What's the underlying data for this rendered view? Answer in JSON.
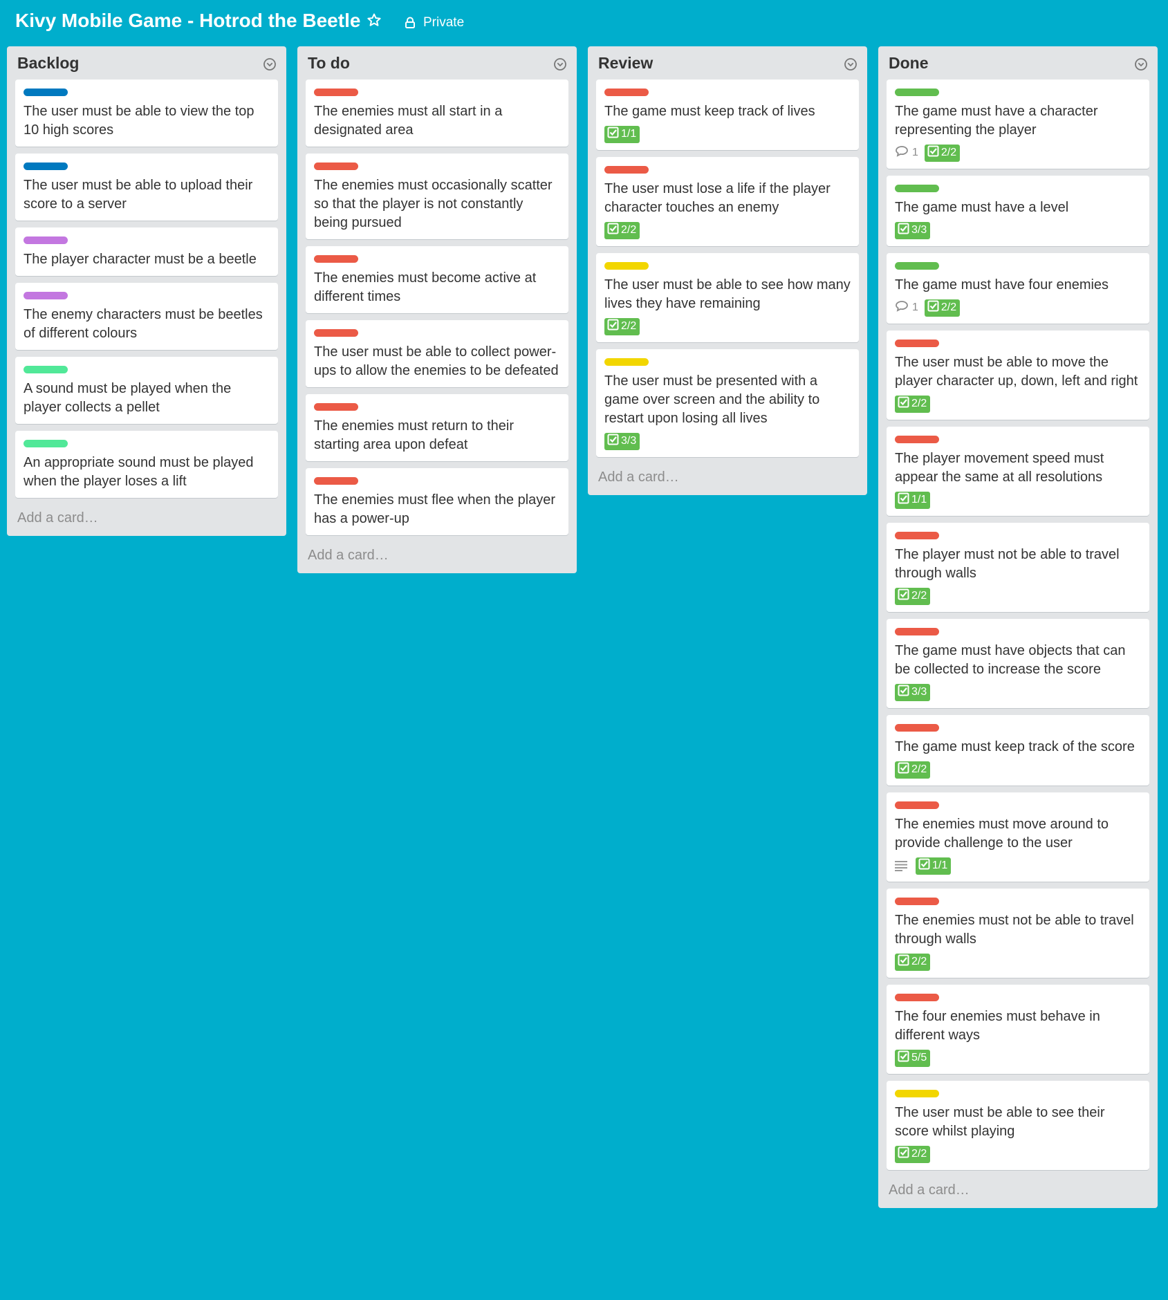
{
  "board": {
    "title": "Kivy Mobile Game - Hotrod the Beetle",
    "visibility": "Private"
  },
  "colors": {
    "background": "#00AECC",
    "list_bg": "#E2E4E6",
    "check_green": "#61BD4F"
  },
  "add_card_label": "Add a card…",
  "lists": [
    {
      "title": "Backlog",
      "cards": [
        {
          "label_color": "#0079BF",
          "text": "The user must be able to view the top 10 high scores"
        },
        {
          "label_color": "#0079BF",
          "text": "The user must be able to upload their score to a server"
        },
        {
          "label_color": "#C377E0",
          "text": "The player character must be a beetle"
        },
        {
          "label_color": "#C377E0",
          "text": "The enemy characters must be beetles of different colours"
        },
        {
          "label_color": "#51E898",
          "text": "A sound must be played when the player collects a pellet"
        },
        {
          "label_color": "#51E898",
          "text": "An appropriate sound must be played when the player loses a lift"
        }
      ]
    },
    {
      "title": "To do",
      "cards": [
        {
          "label_color": "#EB5A46",
          "text": "The enemies must all start in a designated area"
        },
        {
          "label_color": "#EB5A46",
          "text": "The enemies must occasionally scatter so that the player is not constantly being pursued"
        },
        {
          "label_color": "#EB5A46",
          "text": "The enemies must become active at different times"
        },
        {
          "label_color": "#EB5A46",
          "text": "The user must be able to collect power-ups to allow the enemies to be defeated"
        },
        {
          "label_color": "#EB5A46",
          "text": "The enemies must return to their starting area upon defeat"
        },
        {
          "label_color": "#EB5A46",
          "text": "The enemies must flee when the player has a power-up"
        }
      ]
    },
    {
      "title": "Review",
      "cards": [
        {
          "label_color": "#EB5A46",
          "text": "The game must keep track of lives",
          "checklist": "1/1"
        },
        {
          "label_color": "#EB5A46",
          "text": "The user must lose a life if the player character touches an enemy",
          "checklist": "2/2"
        },
        {
          "label_color": "#F2D600",
          "text": "The user must be able to see how many lives they have remaining",
          "checklist": "2/2"
        },
        {
          "label_color": "#F2D600",
          "text": "The user must be presented with a game over screen and the ability to restart upon losing all lives",
          "checklist": "3/3"
        }
      ]
    },
    {
      "title": "Done",
      "cards": [
        {
          "label_color": "#61BD4F",
          "text": "The game must have a character representing the player",
          "comments": "1",
          "checklist": "2/2"
        },
        {
          "label_color": "#61BD4F",
          "text": "The game must have a level",
          "checklist": "3/3"
        },
        {
          "label_color": "#61BD4F",
          "text": "The game must have four enemies",
          "comments": "1",
          "checklist": "2/2"
        },
        {
          "label_color": "#EB5A46",
          "text": "The user must be able to move the player character up, down, left and right",
          "checklist": "2/2"
        },
        {
          "label_color": "#EB5A46",
          "text": "The player movement speed must appear the same at all resolutions",
          "checklist": "1/1"
        },
        {
          "label_color": "#EB5A46",
          "text": "The player must not be able to travel through walls",
          "checklist": "2/2"
        },
        {
          "label_color": "#EB5A46",
          "text": "The game must have objects that can be collected to increase the score",
          "checklist": "3/3"
        },
        {
          "label_color": "#EB5A46",
          "text": "The game must keep track of the score",
          "checklist": "2/2"
        },
        {
          "label_color": "#EB5A46",
          "text": "The enemies must move around to provide challenge to the user",
          "description": true,
          "checklist": "1/1"
        },
        {
          "label_color": "#EB5A46",
          "text": "The enemies must not be able to travel through walls",
          "checklist": "2/2"
        },
        {
          "label_color": "#EB5A46",
          "text": "The four enemies must behave in different ways",
          "checklist": "5/5"
        },
        {
          "label_color": "#F2D600",
          "text": "The user must be able to see their score whilst playing",
          "checklist": "2/2"
        }
      ]
    }
  ]
}
